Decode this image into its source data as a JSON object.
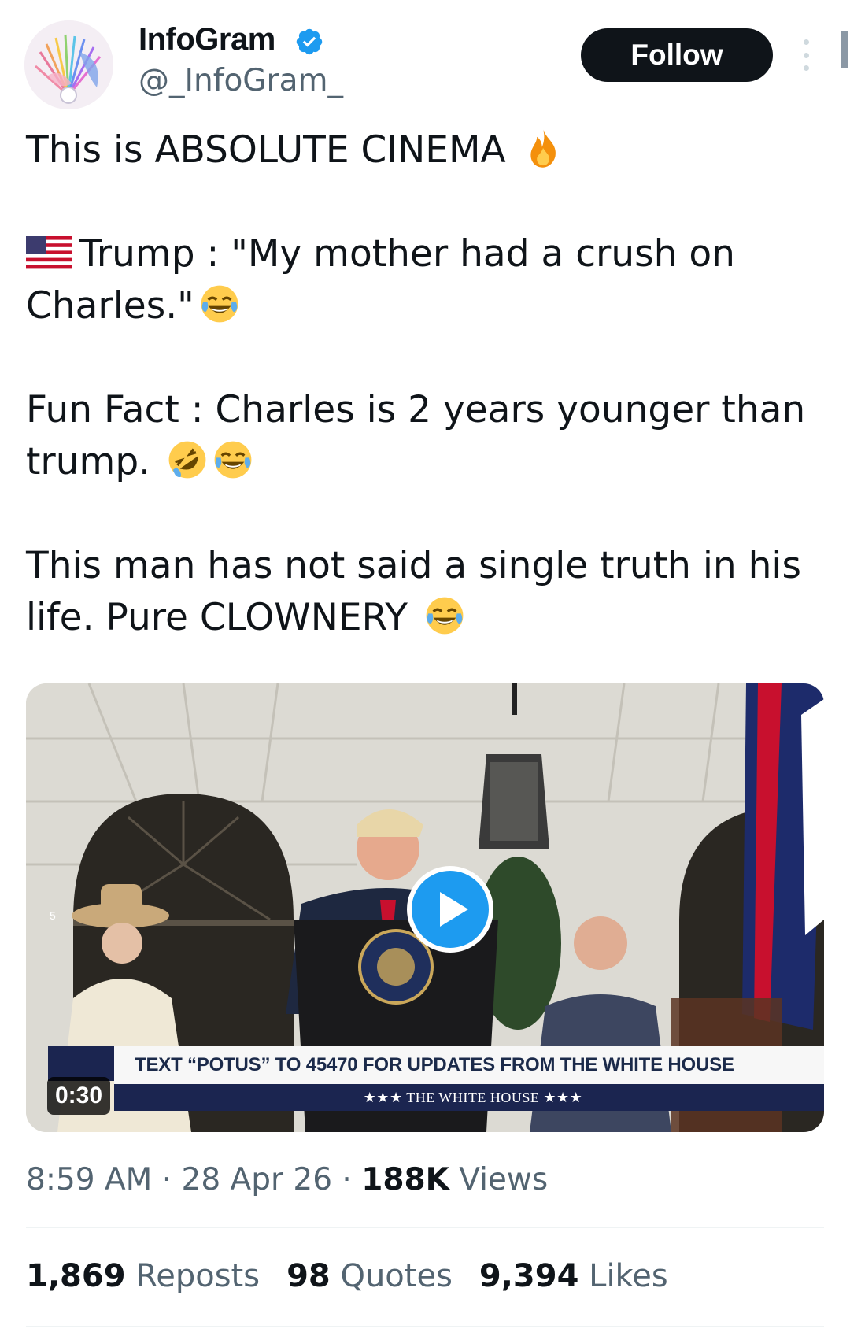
{
  "author": {
    "name": "InfoGram",
    "handle": "@_InfoGram_",
    "verified": true,
    "follow_label": "Follow"
  },
  "tweet": {
    "line1": "This is ABSOLUTE CINEMA ",
    "line2a": "Trump : \"My mother had a crush on",
    "line2b": "Charles.\"",
    "line3a": "Fun Fact : Charles is 2 years younger than",
    "line3b": "trump. ",
    "line4a": "This man has not said a single truth in his",
    "line4b": "life. Pure CLOWNERY ",
    "emojis": [
      "fire-emoji",
      "us-flag-emoji",
      "tears-of-joy-emoji",
      "rolling-laughing-emoji"
    ]
  },
  "media": {
    "duration": "0:30",
    "lower_third": "TEXT “POTUS” TO 45470 FOR UPDATES FROM THE WHITE HOUSE",
    "lower_third_sub": "★★★  THE WHITE HOUSE  ★★★",
    "slide_number": "5"
  },
  "meta": {
    "time": "8:59 AM",
    "separator": " · ",
    "date": "28 Apr 26",
    "views_count": "188K",
    "views_label": " Views"
  },
  "stats": {
    "reposts_count": "1,869",
    "reposts_label": " Reposts",
    "quotes_count": "98",
    "quotes_label": " Quotes",
    "likes_count": "9,394",
    "likes_label": " Likes"
  },
  "colors": {
    "accent": "#1d9bf0",
    "text": "#0f1419",
    "secondary": "#536471"
  }
}
